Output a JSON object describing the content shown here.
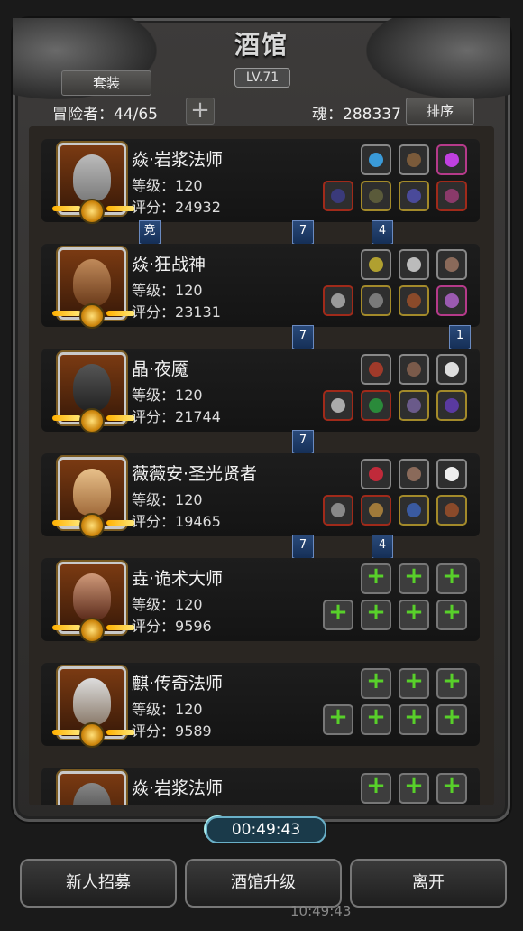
{
  "header": {
    "title": "酒馆",
    "level": "LV.71",
    "suit_button": "套装",
    "adventurers": "冒险者：44/65",
    "add_icon": "plus-icon",
    "soul": "魂：288337",
    "sort_button": "排序"
  },
  "labels": {
    "level_prefix": "等级：",
    "score_prefix": "评分："
  },
  "heroes": [
    {
      "name": "焱·岩浆法师",
      "level": "120",
      "score": "24932"
    },
    {
      "name": "焱·狂战神",
      "level": "120",
      "score": "23131"
    },
    {
      "name": "晶·夜魇",
      "level": "120",
      "score": "21744"
    },
    {
      "name": "薇薇安·圣光贤者",
      "level": "120",
      "score": "19465"
    },
    {
      "name": "垚·诡术大师",
      "level": "120",
      "score": "9596"
    },
    {
      "name": "麒·传奇法师",
      "level": "120",
      "score": "9589"
    },
    {
      "name": "焱·岩浆法师",
      "level": "",
      "score": ""
    }
  ],
  "tags": {
    "t1": "竞",
    "t2": "7",
    "t3": "4",
    "t4": "7",
    "t5": "1",
    "t6": "7",
    "t7": "7",
    "t8": "4"
  },
  "timer": "00:49:43",
  "bottom": {
    "recruit": "新人招募",
    "upgrade": "酒馆升级",
    "leave": "离开"
  },
  "status_clock": "10:49:43",
  "colors": {
    "empty_plus": "#58d02a",
    "tag_blue": "#2a4a7a",
    "medal_gold": "#ffcc33"
  }
}
